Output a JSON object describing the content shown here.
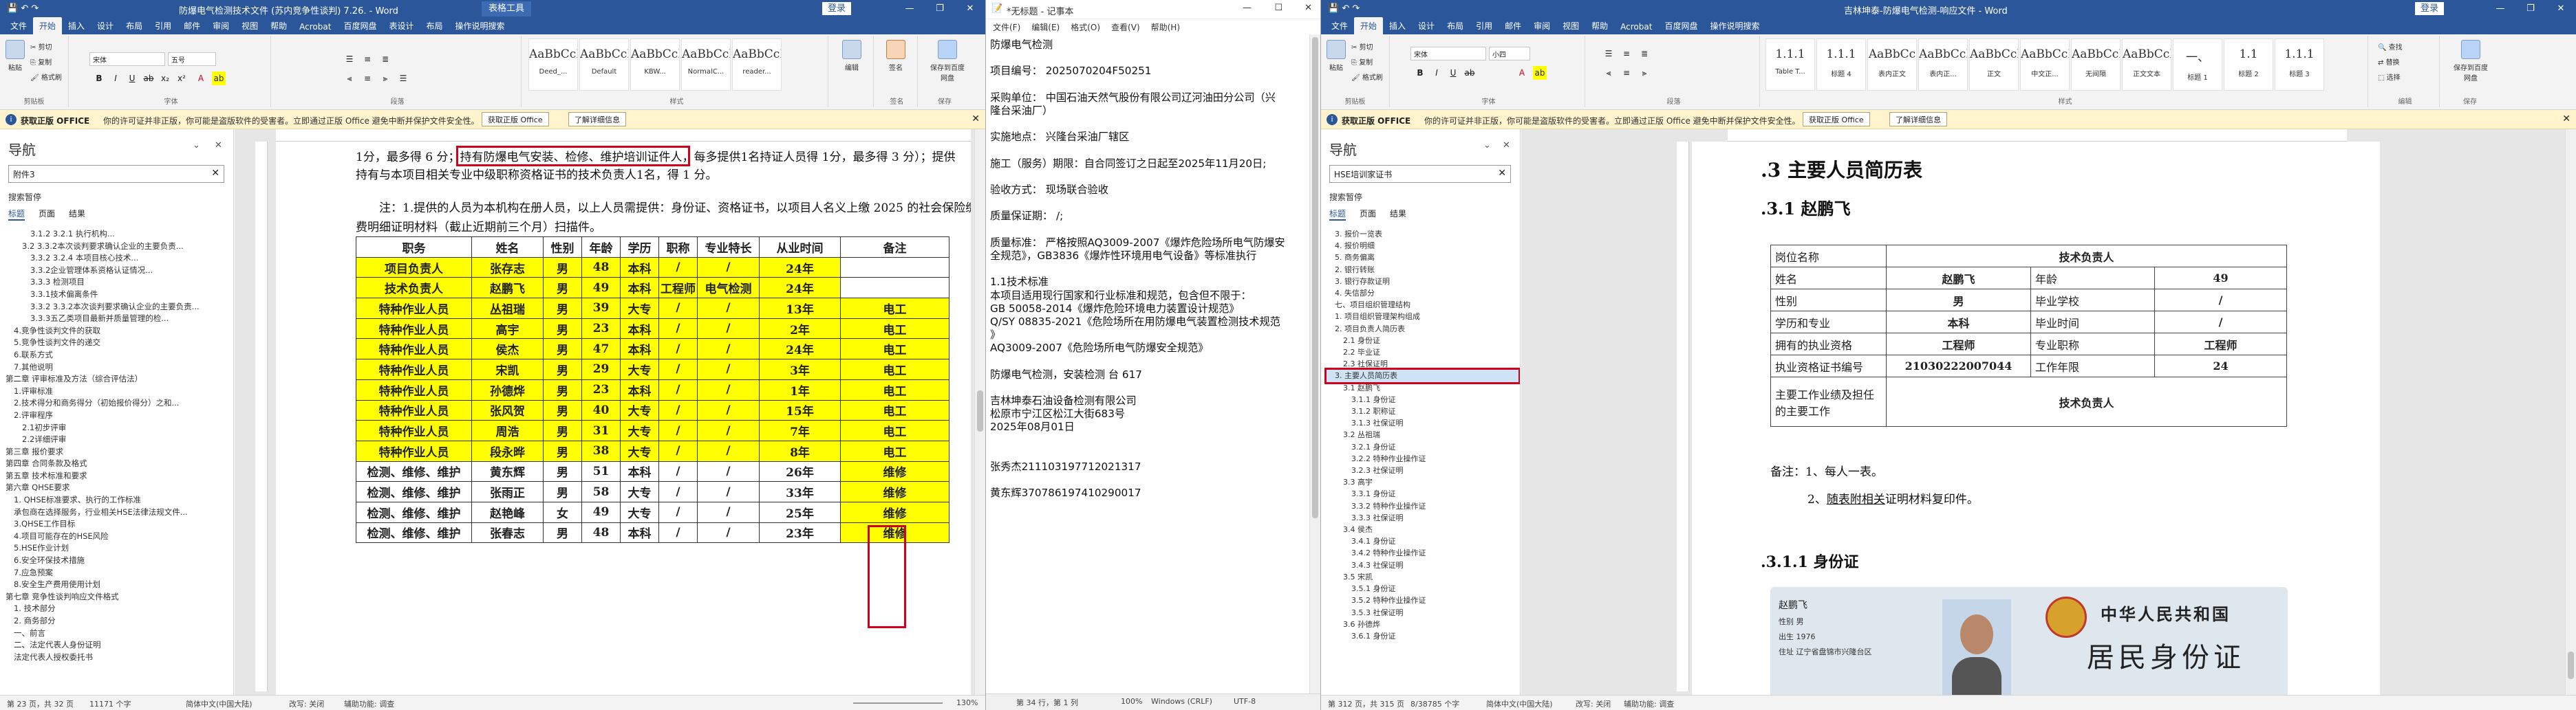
{
  "word1": {
    "title": "防爆电气检测技术文件 (苏内竞争性谈判) 7.26. - Word",
    "context_tab": "表格工具",
    "signin": "登录",
    "share": "共享",
    "tabs": [
      "文件",
      "开始",
      "插入",
      "设计",
      "布局",
      "引用",
      "邮件",
      "审阅",
      "视图",
      "帮助",
      "Acrobat",
      "百度网盘",
      "表设计",
      "布局",
      "操作说明搜索"
    ],
    "active_tab": "开始",
    "ribbon": {
      "paste": "粘贴",
      "cut": "剪切",
      "copy": "复制",
      "format_painter": "格式刷",
      "clipboard": "剪贴板",
      "font_name": "宋体",
      "font_size": "五号",
      "font_group": "字体",
      "paragraph_group": "段落",
      "styles_group": "样式",
      "styles": [
        {
          "preview": "AaBbCcDd",
          "label": "Deed_..."
        },
        {
          "preview": "AaBbCcI",
          "label": "Default"
        },
        {
          "preview": "AaBbCcI",
          "label": "KBW..."
        },
        {
          "preview": "AaBbCcI",
          "label": "NormalC..."
        },
        {
          "preview": "AaBbCcDd",
          "label": "reader..."
        }
      ],
      "edit": "编辑",
      "sign": "签名",
      "save_baidu": "保存到百度网盘",
      "save_group": "保存",
      "sign_group": "签名"
    },
    "msg": {
      "title": "获取正版 OFFICE",
      "text": "你的许可证并非正版，你可能是盗版软件的受害者。立即通过正版 Office 避免中断并保护文件安全性。",
      "btn1": "获取正版 Office",
      "btn2": "了解详细信息"
    },
    "nav": {
      "title": "导航",
      "search_value": "附件3",
      "search_result": "搜索暂停",
      "tabs": [
        "标题",
        "页面",
        "结果"
      ],
      "items": [
        "3.1.2 3.2.1 执行机构...",
        "3.2 3.3.2本次谈判要求确认企业的主要负责...",
        "3.3.2 3.2.4 本项目核心技术...",
        "3.3.2企业管理体系资格认证情况...",
        "3.3.3 检测项目",
        "3.3.1技术偏离条件",
        "3.3.2 3.3.2本次谈判要求确认企业的主要负责...",
        "3.3.3五乙类项目最新并质量管理的检...",
        "4.竞争性谈判文件的获取",
        "5.竞争性谈判文件的递交",
        "6.联系方式",
        "7.其他说明",
        "第二章 评审标准及方法（综合评估法）",
        "1.评审标准",
        "2.技术得分和商务得分（初始报价得分）之和...",
        "2.评审程序",
        "2.1初步评审",
        "2.2详细评审",
        "第三章 报价要求",
        "第四章 合同条款及格式",
        "第五章 技术标准和要求",
        "第六章 QHSE要求",
        "1. QHSE标准要求、执行的工作标准",
        "承包商在选择服务，行业相关HSE法律法规文件...",
        "3.QHSE工作目标",
        "4.项目可能存在的HSE风险",
        "5.HSE作业计划",
        "6.安全环保技术措施",
        "7.应急预案",
        "8.安全生产费用使用计划",
        "第七章 竞争性谈判响应文件格式",
        "1. 技术部分",
        "2. 商务部分",
        "一、前言",
        "二、法定代表人身份证明",
        "法定代表人授权委托书"
      ]
    },
    "doc": {
      "line1_a": "1分，最多得 6 分；",
      "line1_box": "持有防爆电气安装、检修、维护培训证件",
      "line1_b": "人，每多提供1名持证人员得 1分，最多得 3 分）；提供",
      "line2": "持有与本项目相关专业中级职称资格证书的技术负责人1名，得 1 分。",
      "note1": "注：1.提供的人员为本机构在册人员，以上人员需提供：身份证、资格证书，以项目人名义上缴 2025 的社会保险缴",
      "note2": "费明细证明材料（截止近期前三个月）扫描件。",
      "headers": [
        "职务",
        "姓名",
        "性别",
        "年龄",
        "学历",
        "职称",
        "专业特长",
        "从业时间",
        "备注"
      ],
      "rows": [
        [
          "项目负责人",
          "张存志",
          "男",
          "48",
          "本科",
          "/",
          "/",
          "24年",
          ""
        ],
        [
          "技术负责人",
          "赵鹏飞",
          "男",
          "49",
          "本科",
          "工程师",
          "电气检测",
          "24年",
          ""
        ],
        [
          "特种作业人员",
          "丛祖瑞",
          "男",
          "39",
          "大专",
          "/",
          "/",
          "13年",
          "电工"
        ],
        [
          "特种作业人员",
          "高宇",
          "男",
          "23",
          "本科",
          "/",
          "/",
          "2年",
          "电工"
        ],
        [
          "特种作业人员",
          "侯杰",
          "男",
          "47",
          "本科",
          "/",
          "/",
          "24年",
          "电工"
        ],
        [
          "特种作业人员",
          "宋凯",
          "男",
          "29",
          "大专",
          "/",
          "/",
          "3年",
          "电工"
        ],
        [
          "特种作业人员",
          "孙德烨",
          "男",
          "23",
          "本科",
          "/",
          "/",
          "1年",
          "电工"
        ],
        [
          "特种作业人员",
          "张风贺",
          "男",
          "40",
          "大专",
          "/",
          "/",
          "15年",
          "电工"
        ],
        [
          "特种作业人员",
          "周浩",
          "男",
          "31",
          "大专",
          "/",
          "/",
          "7年",
          "电工"
        ],
        [
          "特种作业人员",
          "段永晔",
          "男",
          "38",
          "大专",
          "/",
          "/",
          "8年",
          "电工"
        ],
        [
          "检测、维修、维护",
          "黄东辉",
          "男",
          "51",
          "本科",
          "/",
          "/",
          "26年",
          "维修"
        ],
        [
          "检测、维修、维护",
          "张雨正",
          "男",
          "58",
          "大专",
          "/",
          "/",
          "33年",
          "维修"
        ],
        [
          "检测、维修、维护",
          "赵艳峰",
          "女",
          "49",
          "大专",
          "/",
          "/",
          "25年",
          "维修"
        ],
        [
          "检测、维修、维护",
          "张春志",
          "男",
          "48",
          "本科",
          "/",
          "/",
          "23年",
          "维修"
        ]
      ]
    },
    "status": {
      "page": "第 23 页，共 32 页",
      "words": "11171 个字",
      "lang": "简体中文(中国大陆)",
      "mode": "改写: 关闭",
      "access": "辅助功能: 调查",
      "zoom": "130%"
    }
  },
  "notepad": {
    "title": "*无标题 - 记事本",
    "menu": [
      "文件(F)",
      "编辑(E)",
      "格式(O)",
      "查看(V)",
      "帮助(H)"
    ],
    "lines": [
      "防爆电气检测",
      "",
      "项目编号：  2025070204F50251",
      "",
      "采购单位：  中国石油天然气股份有限公司辽河油田分公司（兴",
      "隆台采油厂）",
      "",
      "实施地点：  兴隆台采油厂辖区",
      "",
      "施工（服务）期限：自合同签订之日起至2025年11月20日;",
      "",
      "验收方式：  现场联合验收",
      "",
      "质量保证期：  /;",
      "",
      "质量标准：  严格按照AQ3009-2007《爆炸危险场所电气防爆安",
      "全规范》，GB3836《爆炸性环境用电气设备》等标准执行",
      "",
      "1.1技术标准",
      "本项目适用现行国家和行业标准和规范，包含但不限于：",
      "GB 50058-2014《爆炸危险环境电力装置设计规范》",
      "Q/SY 08835-2021《危险场所在用防爆电气装置检测技术规范",
      "》",
      "AQ3009-2007《危险场所电气防爆安全规范》",
      "",
      "防爆电气检测，安装检测        台          617",
      "",
      "吉林坤泰石油设备检测有限公司",
      "松原市宁江区松江大街683号",
      "2025年08月01日",
      "",
      "",
      "张秀杰211103197712021317",
      "",
      "黄东辉370786197410290017"
    ],
    "status": {
      "pos": "第 34 行，第 1 列",
      "zoom": "100%",
      "eol": "Windows (CRLF)",
      "enc": "UTF-8"
    }
  },
  "word3": {
    "title": "吉林坤泰-防爆电气检测-响应文件 - Word",
    "signin": "登录",
    "share": "共享",
    "tabs": [
      "文件",
      "开始",
      "插入",
      "设计",
      "布局",
      "引用",
      "邮件",
      "审阅",
      "视图",
      "帮助",
      "Acrobat",
      "百度网盘",
      "操作说明搜索"
    ],
    "active_tab": "开始",
    "ribbon": {
      "paste": "粘贴",
      "cut": "剪切",
      "copy": "复制",
      "format_painter": "格式刷",
      "clipboard": "剪贴板",
      "font_name": "宋体",
      "font_size": "小四",
      "font_group": "字体",
      "paragraph_group": "段落",
      "styles_group": "样式",
      "styles": [
        {
          "preview": "1.1.1",
          "label": "Table T..."
        },
        {
          "preview": "1.1.1",
          "label": "标题 4"
        },
        {
          "preview": "AaBbCc",
          "label": "表内正文"
        },
        {
          "preview": "AaBbCcI",
          "label": "表内正..."
        },
        {
          "preview": "AaBbCcI",
          "label": "正文"
        },
        {
          "preview": "AaBbCcI",
          "label": "中文正..."
        },
        {
          "preview": "AaBbCcI",
          "label": "无间隔"
        },
        {
          "preview": "AaBbCcI",
          "label": "正文文本"
        },
        {
          "preview": "一、",
          "label": "标题 1"
        },
        {
          "preview": "1.1",
          "label": "标题 2"
        },
        {
          "preview": "1.1.1",
          "label": "标题 3"
        }
      ],
      "find": "查找",
      "replace": "替换",
      "select": "选择",
      "edit_group": "编辑",
      "save_baidu": "保存到百度网盘",
      "save_group": "保存"
    },
    "msg": {
      "title": "获取正版 OFFICE",
      "text": "你的许可证并非正版，你可能是盗版软件的受害者。立即通过正版 Office 避免中断并保护文件安全性。",
      "btn1": "获取正版 Office",
      "btn2": "了解详细信息"
    },
    "nav": {
      "title": "导航",
      "search_value": "HSE培训家证书",
      "search_result": "搜索暂停",
      "tabs": [
        "标题",
        "页面",
        "结果"
      ],
      "items": [
        "3. 报价一览表",
        "4. 报价明细",
        "5. 商务偏离",
        "2. 银行转账",
        "3. 银行存款证明",
        "4. 失信部分",
        "七、项目组织管理结构",
        "1. 项目组织管理架构组成",
        "2. 项目负责人简历表",
        "2.1 身份证",
        "2.2 毕业证",
        "2.3 社保证明",
        "3. 主要人员简历表",
        "3.1 赵鹏飞",
        "3.1.1 身份证",
        "3.1.2 职称证",
        "3.1.3 社保证明",
        "3.2 丛祖瑞",
        "3.2.1 身份证",
        "3.2.2 特种作业操作证",
        "3.2.3 社保证明",
        "3.3 高宇",
        "3.3.1 身份证",
        "3.3.2 特种作业操作证",
        "3.3.3 社保证明",
        "3.4 侯杰",
        "3.4.1 身份证",
        "3.4.2 特种作业操作证",
        "3.4.3 社保证明",
        "3.5 宋凯",
        "3.5.1 身份证",
        "3.5.2 特种作业操作证",
        "3.5.3 社保证明",
        "3.6 孙德烨",
        "3.6.1 身份证"
      ],
      "selected_index": 12
    },
    "doc": {
      "h1": ".3  主要人员简历表",
      "h2": ".3.1    赵鹏飞",
      "table": [
        [
          "岗位名称",
          "技术负责人"
        ],
        [
          "姓名",
          "赵鹏飞",
          "年龄",
          "49"
        ],
        [
          "性别",
          "男",
          "毕业学校",
          "/"
        ],
        [
          "学历和专业",
          "本科",
          "毕业时间",
          "/"
        ],
        [
          "拥有的执业资格",
          "工程师",
          "专业职称",
          "工程师"
        ],
        [
          "执业资格证书编号",
          "21030222007044",
          "工作年限",
          "24"
        ],
        [
          "主要工作业绩及担任的主要工作",
          "技术负责人"
        ]
      ],
      "note1": "备注：1、每人一表。",
      "note2a": "2、",
      "note2b": "随表附相关",
      "note2c": "证明材料复印件。",
      "h3": ".3.1.1  身份证",
      "id_country": "中华人民共和国",
      "id_title": "居民身份证",
      "id_name": "赵鹏飞",
      "id_lines": [
        "性别 男",
        "出生 1976",
        "住址 辽宁省盘锦市兴隆台区"
      ]
    },
    "status": {
      "page": "第 312 页，共 315 页",
      "words": "8/38785 个字",
      "lang": "简体中文(中国大陆)",
      "mode": "改写: 关闭",
      "access": "辅助功能: 调查"
    }
  }
}
